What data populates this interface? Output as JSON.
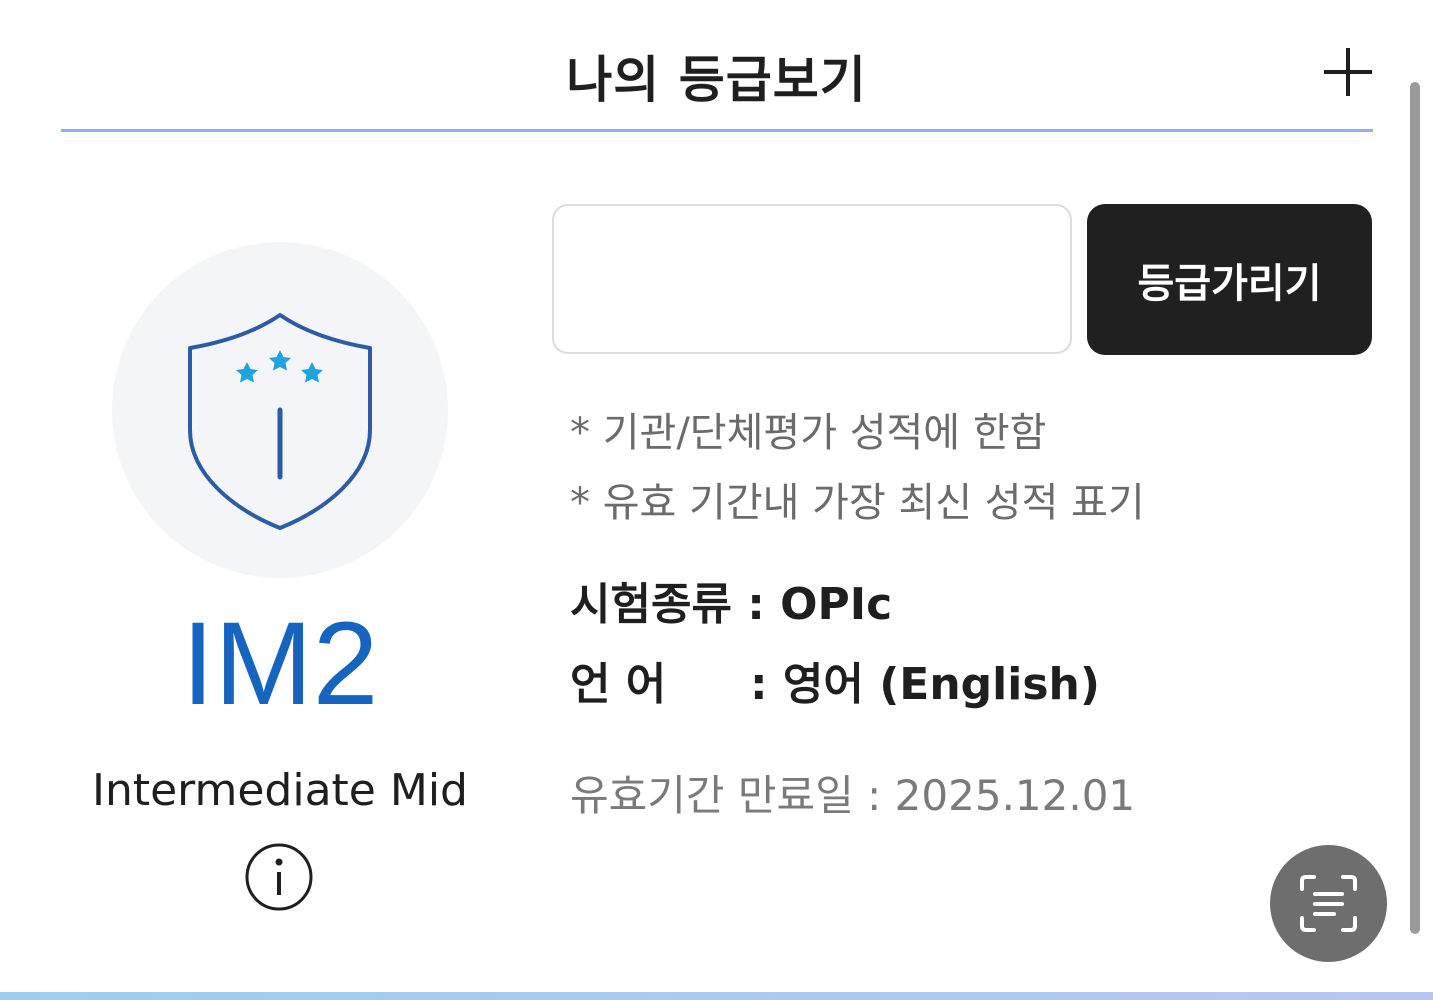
{
  "header": {
    "title": "나의 등급보기",
    "add_icon": "plus-icon"
  },
  "grade": {
    "badge_icon": "shield-stars-icon",
    "code": "IM2",
    "name": "Intermediate Mid",
    "info_icon": "info-icon"
  },
  "controls": {
    "input_value": "",
    "hide_button_label": "등급가리기"
  },
  "notes": [
    "* 기관/단체평가 성적에 한함",
    "* 유효 기간내 가장 최신 성적 표기"
  ],
  "details": {
    "exam_type": "시험종류 : OPIc",
    "language_label": "언 어",
    "language_value": ": 영어 (English)"
  },
  "expiry": "유효기간 만료일 : 2025.12.01",
  "fab": {
    "icon": "scan-text-icon"
  },
  "colors": {
    "grade_blue": "#1565c0",
    "divider": "#8fb3ea",
    "star_cyan": "#1fa3dc",
    "button_dark": "#202020"
  }
}
